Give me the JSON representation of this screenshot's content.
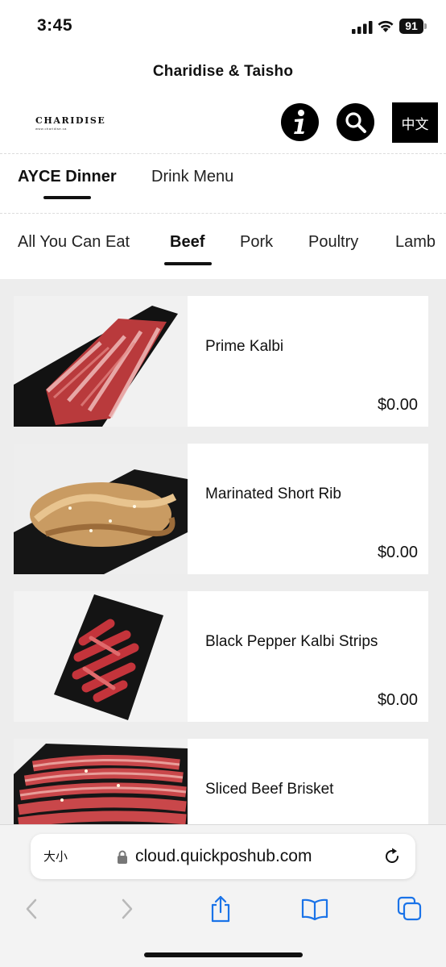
{
  "status": {
    "time": "3:45",
    "battery": "91"
  },
  "header": {
    "title": "Charidise & Taisho",
    "logo_text": "CHARIDISE",
    "logo_subtext": "www.charidise.ca",
    "lang_label": "中文"
  },
  "menu_tabs": [
    {
      "label": "AYCE Dinner",
      "active": true
    },
    {
      "label": "Drink Menu",
      "active": false
    }
  ],
  "category_tabs": [
    {
      "label": "All You Can Eat",
      "active": false
    },
    {
      "label": "Beef",
      "active": true
    },
    {
      "label": "Pork",
      "active": false
    },
    {
      "label": "Poultry",
      "active": false
    },
    {
      "label": "Lamb",
      "active": false
    }
  ],
  "items": [
    {
      "name": "Prime Kalbi",
      "price": "$0.00"
    },
    {
      "name": "Marinated Short Rib",
      "price": "$0.00"
    },
    {
      "name": "Black Pepper Kalbi Strips",
      "price": "$0.00"
    },
    {
      "name": "Sliced Beef Brisket",
      "price": ""
    }
  ],
  "browser": {
    "text_size_label": "大小",
    "url": "cloud.quickposhub.com"
  },
  "icons": {
    "info": "info-icon",
    "search": "search-icon",
    "lock": "lock-icon",
    "reload": "reload-icon",
    "back": "chevron-left-icon",
    "forward": "chevron-right-icon",
    "share": "share-icon",
    "bookmarks": "book-icon",
    "tabs": "tabs-icon"
  },
  "colors": {
    "accent": "#000000",
    "list_background": "#ededed",
    "browser_blue": "#1a73e8"
  }
}
